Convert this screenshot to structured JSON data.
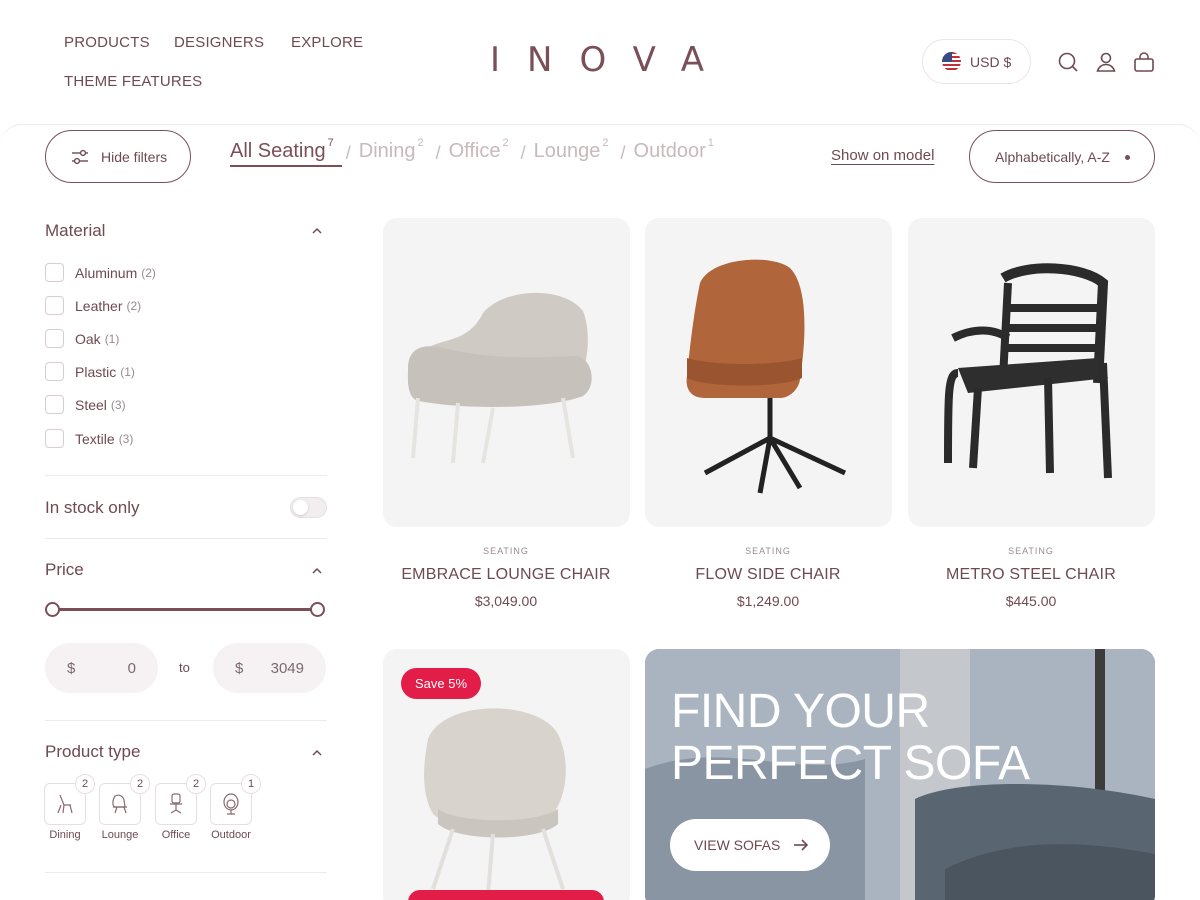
{
  "nav": [
    "PRODUCTS",
    "DESIGNERS",
    "EXPLORE",
    "THEME FEATURES"
  ],
  "logo": "INOVA",
  "currency": "USD $",
  "header_icons": [
    "search-icon",
    "account-icon",
    "cart-icon"
  ],
  "toolbar": {
    "hide_filters": "Hide filters",
    "tabs": [
      {
        "label": "All Seating",
        "count": "7"
      },
      {
        "label": "Dining",
        "count": "2"
      },
      {
        "label": "Office",
        "count": "2"
      },
      {
        "label": "Lounge",
        "count": "2"
      },
      {
        "label": "Outdoor",
        "count": "1"
      }
    ],
    "separator": "/",
    "show_on_model": "Show on model",
    "sort": "Alphabetically, A-Z"
  },
  "filters": {
    "material_title": "Material",
    "materials": [
      {
        "label": "Aluminum",
        "count": "(2)"
      },
      {
        "label": "Leather",
        "count": "(2)"
      },
      {
        "label": "Oak",
        "count": "(1)"
      },
      {
        "label": "Plastic",
        "count": "(1)"
      },
      {
        "label": "Steel",
        "count": "(3)"
      },
      {
        "label": "Textile",
        "count": "(3)"
      }
    ],
    "in_stock_label": "In stock only",
    "in_stock": false,
    "price_title": "Price",
    "price_currency": "$",
    "price_min": "0",
    "price_max": "3049",
    "price_to": "to",
    "price_range_fraction": [
      0,
      1
    ],
    "product_type_title": "Product type",
    "product_types": [
      {
        "label": "Dining",
        "count": "2",
        "icon": "dining-chair-icon"
      },
      {
        "label": "Lounge",
        "count": "2",
        "icon": "lounge-chair-icon"
      },
      {
        "label": "Office",
        "count": "2",
        "icon": "office-chair-icon"
      },
      {
        "label": "Outdoor",
        "count": "1",
        "icon": "outdoor-chair-icon"
      }
    ]
  },
  "products": [
    {
      "category": "SEATING",
      "name": "EMBRACE LOUNGE CHAIR",
      "price": "$3,049.00"
    },
    {
      "category": "SEATING",
      "name": "FLOW SIDE CHAIR",
      "price": "$1,249.00"
    },
    {
      "category": "SEATING",
      "name": "METRO STEEL CHAIR",
      "price": "$445.00"
    },
    {
      "badge": "Save 5%"
    }
  ],
  "promo": {
    "title_line1": "FIND YOUR",
    "title_line2": "PERFECT SOFA",
    "button": "VIEW SOFAS"
  },
  "colors": {
    "brand": "#7a4f58",
    "sale": "#e11d48",
    "muted_tab": "#c9b8bc"
  }
}
